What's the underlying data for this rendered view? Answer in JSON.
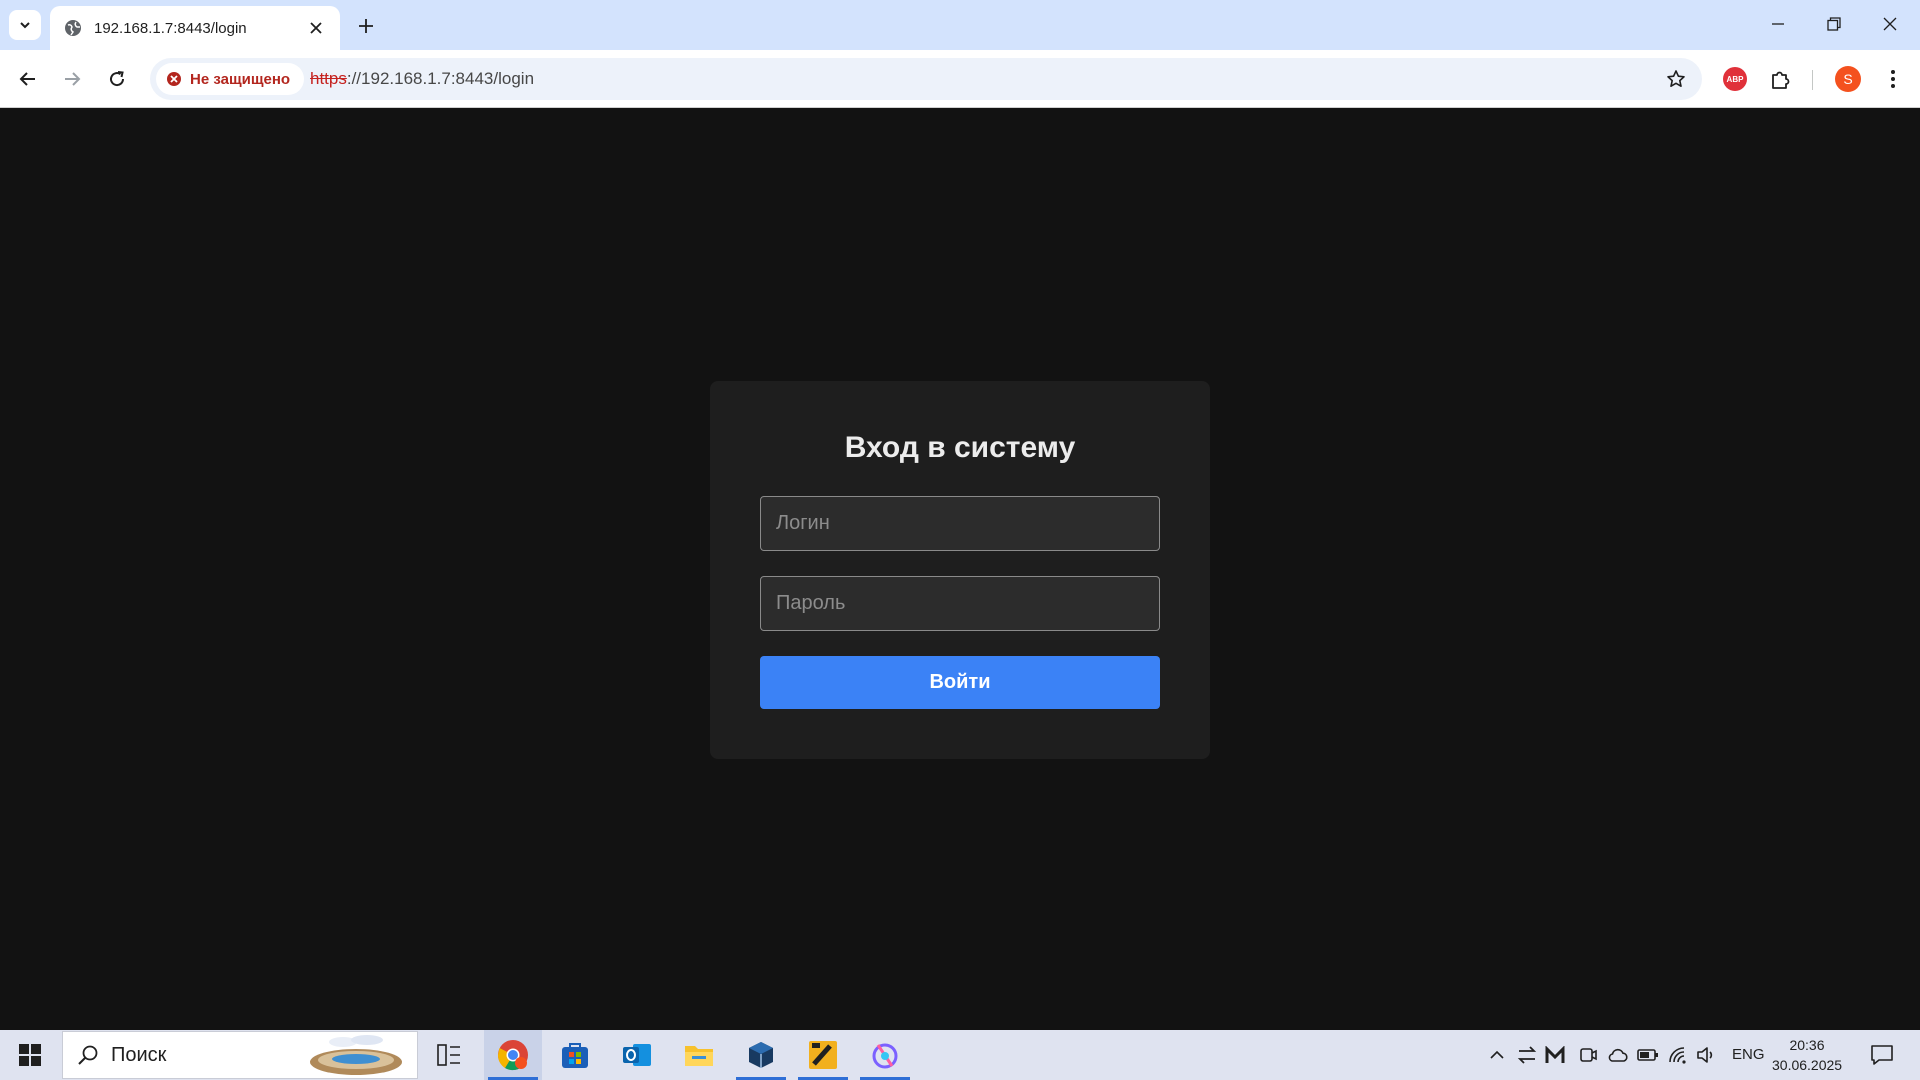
{
  "browser": {
    "tab": {
      "title": "192.168.1.7:8443/login"
    },
    "omnibox": {
      "security_label": "Не защищено",
      "url_scheme": "https",
      "url_rest": "://192.168.1.7:8443/login"
    },
    "profile_initial": "S",
    "extension_badge": "ABP"
  },
  "login": {
    "title": "Вход в систему",
    "login_placeholder": "Логин",
    "password_placeholder": "Пароль",
    "submit_label": "Войти"
  },
  "taskbar": {
    "search_label": "Поиск",
    "language": "ENG",
    "time": "20:36",
    "date": "30.06.2025"
  },
  "colors": {
    "page_background": "#121212",
    "card_background": "#1e1e1e",
    "button_accent": "#3b82f6",
    "insecure_red": "#c5221f"
  }
}
